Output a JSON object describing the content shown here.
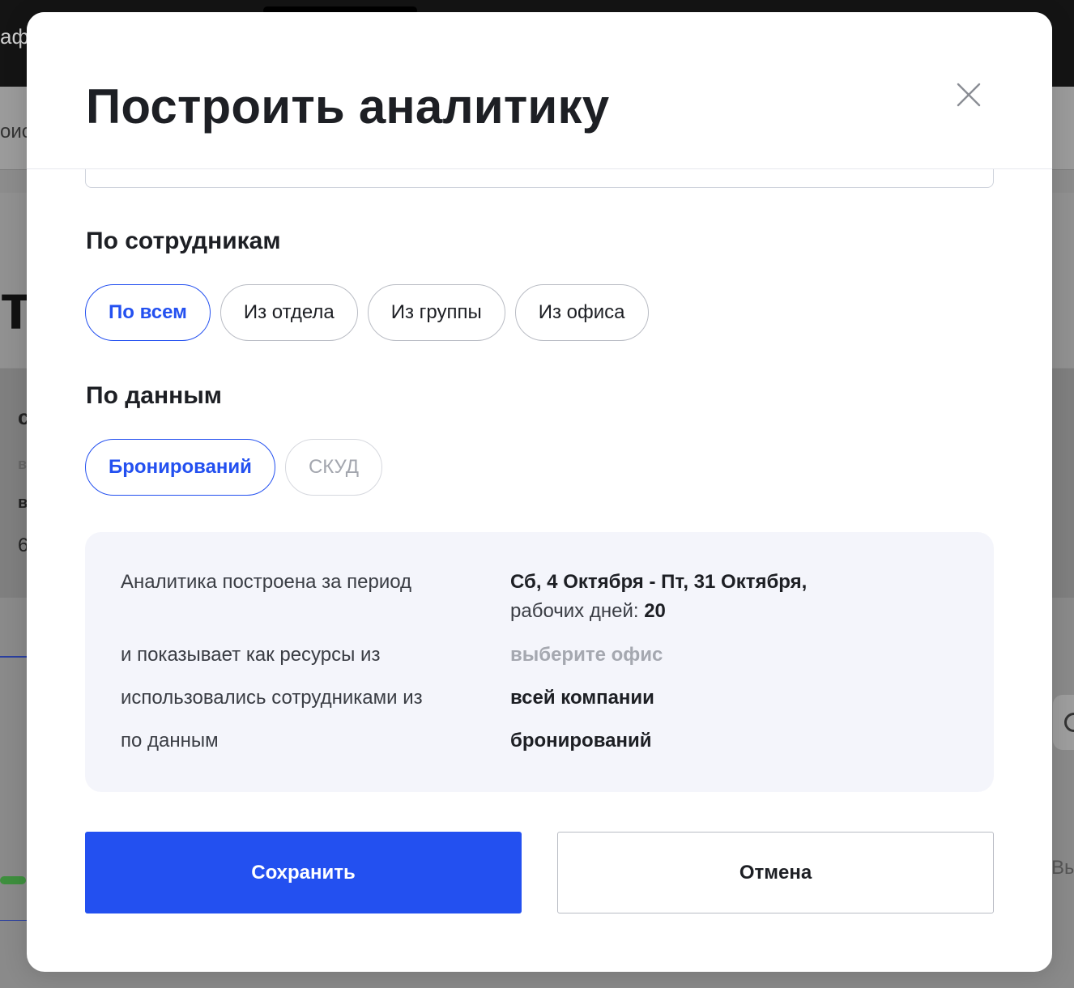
{
  "background": {
    "brand_fragment": "афі",
    "subnav_fragment": "оис",
    "hero_fragment": "ть",
    "card": {
      "line1": "с",
      "line2": "в",
      "line3": "в",
      "line4": "6"
    },
    "right_fragment": "Вы"
  },
  "modal": {
    "title": "Построить аналитику",
    "close_label": "×"
  },
  "employees": {
    "title": "По сотрудникам",
    "options": [
      {
        "label": "По всем",
        "state": "active"
      },
      {
        "label": "Из отдела",
        "state": "default"
      },
      {
        "label": "Из группы",
        "state": "default"
      },
      {
        "label": "Из офиса",
        "state": "default"
      }
    ]
  },
  "data_source": {
    "title": "По данным",
    "options": [
      {
        "label": "Бронирований",
        "state": "active"
      },
      {
        "label": "СКУД",
        "state": "disabled"
      }
    ]
  },
  "summary": {
    "period_label": "Аналитика построена за период",
    "period_value": "Сб, 4 Октября - Пт, 31 Октября,",
    "workdays_label": "рабочих дней:",
    "workdays_value": "20",
    "resources_label": "и показывает как ресурсы из",
    "resources_value": "выберите офис",
    "employees_label": "использовались сотрудниками из",
    "employees_value": "всей компании",
    "source_label": "по данным",
    "source_value": "бронирований"
  },
  "actions": {
    "save_label": "Сохранить",
    "cancel_label": "Отмена"
  },
  "colors": {
    "accent": "#2350f0",
    "text": "#1d1f24",
    "muted": "#a5a8b0",
    "summary_bg": "#f4f5fb"
  }
}
